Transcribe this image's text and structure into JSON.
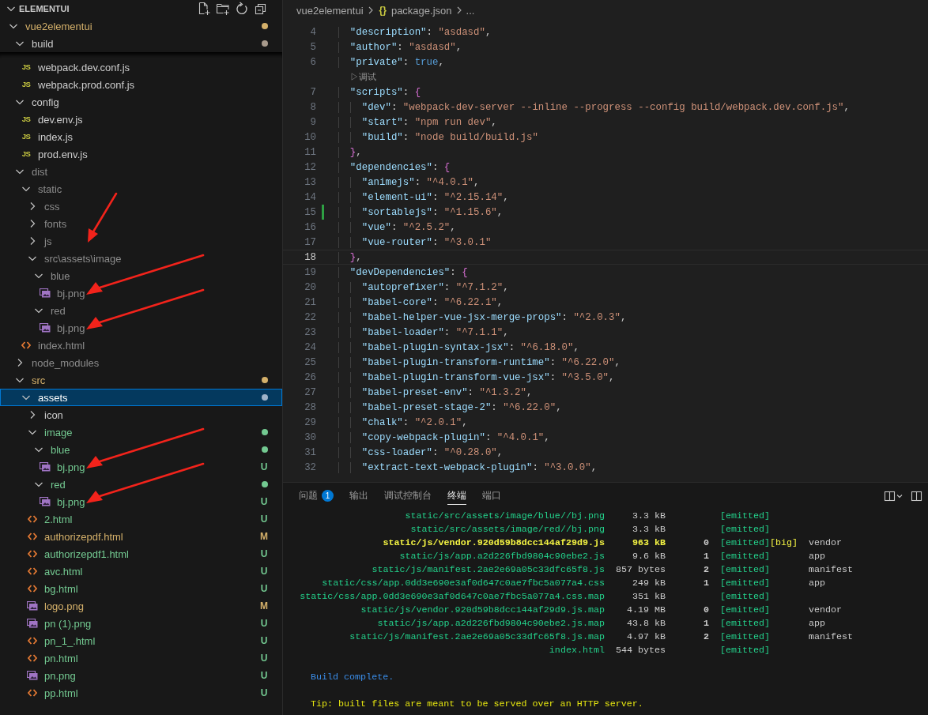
{
  "explorer": {
    "title": "ELEMENTUI",
    "tree": [
      {
        "name": "vue2elementui",
        "kind": "folder",
        "expanded": true,
        "color": "#d4b06a",
        "dot": true,
        "selected": false,
        "children": [
          {
            "name": "build",
            "kind": "folder",
            "expanded": true,
            "color": "#a89a8c",
            "dot": true,
            "selected": false,
            "children": [
              {
                "name": "webpack.dev.conf.js",
                "kind": "js",
                "icon_text": "JS",
                "color": "#cccccc",
                "selected": false
              },
              {
                "name": "webpack.prod.conf.js",
                "kind": "js",
                "icon_text": "JS",
                "color": "#cccccc",
                "selected": false
              }
            ]
          },
          {
            "name": "config",
            "kind": "folder",
            "expanded": true,
            "color": "#cccccc",
            "selected": false,
            "children": [
              {
                "name": "dev.env.js",
                "kind": "js",
                "icon_text": "JS",
                "color": "#cccccc",
                "selected": false
              },
              {
                "name": "index.js",
                "kind": "js",
                "icon_text": "JS",
                "color": "#cccccc",
                "selected": false
              },
              {
                "name": "prod.env.js",
                "kind": "js",
                "icon_text": "JS",
                "color": "#cccccc",
                "selected": false
              }
            ]
          },
          {
            "name": "dist",
            "kind": "folder",
            "expanded": true,
            "color": "#8c8c8c",
            "selected": false,
            "children": [
              {
                "name": "static",
                "kind": "folder",
                "expanded": true,
                "color": "#8c8c8c",
                "selected": false,
                "children": [
                  {
                    "name": "css",
                    "kind": "folder",
                    "expanded": false,
                    "color": "#8c8c8c",
                    "selected": false
                  },
                  {
                    "name": "fonts",
                    "kind": "folder",
                    "expanded": false,
                    "color": "#8c8c8c",
                    "selected": false
                  },
                  {
                    "name": "js",
                    "kind": "folder",
                    "expanded": false,
                    "color": "#8c8c8c",
                    "selected": false,
                    "arrow": true
                  },
                  {
                    "name": "src\\assets\\image",
                    "kind": "folder",
                    "expanded": true,
                    "color": "#8c8c8c",
                    "selected": false,
                    "children": [
                      {
                        "name": "blue",
                        "kind": "folder",
                        "expanded": true,
                        "color": "#8c8c8c",
                        "selected": false,
                        "children": [
                          {
                            "name": "bj.png",
                            "kind": "image",
                            "color": "#8c8c8c",
                            "selected": false,
                            "arrow": true
                          }
                        ]
                      },
                      {
                        "name": "red",
                        "kind": "folder",
                        "expanded": true,
                        "color": "#8c8c8c",
                        "selected": false,
                        "children": [
                          {
                            "name": "bj.png",
                            "kind": "image",
                            "color": "#8c8c8c",
                            "selected": false,
                            "arrow": true
                          }
                        ]
                      }
                    ]
                  }
                ]
              },
              {
                "name": "index.html",
                "kind": "html",
                "color": "#8c8c8c",
                "selected": false
              }
            ]
          },
          {
            "name": "node_modules",
            "kind": "folder",
            "expanded": false,
            "color": "#8c8c8c",
            "selected": false
          },
          {
            "name": "src",
            "kind": "folder",
            "expanded": true,
            "color": "#d4b06a",
            "dot": true,
            "selected": false,
            "children": [
              {
                "name": "assets",
                "kind": "folder",
                "expanded": true,
                "color": "#9fb3c8",
                "dot": true,
                "selected": true,
                "children": [
                  {
                    "name": "icon",
                    "kind": "folder",
                    "expanded": false,
                    "color": "#cccccc",
                    "selected": false
                  },
                  {
                    "name": "image",
                    "kind": "folder",
                    "expanded": true,
                    "color": "#73c991",
                    "dot": true,
                    "selected": false,
                    "children": [
                      {
                        "name": "blue",
                        "kind": "folder",
                        "expanded": true,
                        "color": "#73c991",
                        "dot": true,
                        "selected": false,
                        "children": [
                          {
                            "name": "bj.png",
                            "kind": "image",
                            "color": "#73c991",
                            "badge": "U",
                            "selected": false,
                            "arrow": true
                          }
                        ]
                      },
                      {
                        "name": "red",
                        "kind": "folder",
                        "expanded": true,
                        "color": "#73c991",
                        "dot": true,
                        "selected": false,
                        "children": [
                          {
                            "name": "bj.png",
                            "kind": "image",
                            "color": "#73c991",
                            "badge": "U",
                            "selected": false,
                            "arrow": true
                          }
                        ]
                      }
                    ]
                  },
                  {
                    "name": "2.html",
                    "kind": "html",
                    "color": "#73c991",
                    "badge": "U",
                    "selected": false
                  },
                  {
                    "name": "authorizepdf.html",
                    "kind": "html",
                    "color": "#d4b06a",
                    "badge": "M",
                    "selected": false
                  },
                  {
                    "name": "authorizepdf1.html",
                    "kind": "html",
                    "color": "#73c991",
                    "badge": "U",
                    "selected": false
                  },
                  {
                    "name": "avc.html",
                    "kind": "html",
                    "color": "#73c991",
                    "badge": "U",
                    "selected": false
                  },
                  {
                    "name": "bg.html",
                    "kind": "html",
                    "color": "#73c991",
                    "badge": "U",
                    "selected": false
                  },
                  {
                    "name": "logo.png",
                    "kind": "image",
                    "color": "#d4b06a",
                    "badge": "M",
                    "selected": false
                  },
                  {
                    "name": "pn (1).png",
                    "kind": "image",
                    "color": "#73c991",
                    "badge": "U",
                    "selected": false
                  },
                  {
                    "name": "pn_1_.html",
                    "kind": "html",
                    "color": "#73c991",
                    "badge": "U",
                    "selected": false
                  },
                  {
                    "name": "pn.html",
                    "kind": "html",
                    "color": "#73c991",
                    "badge": "U",
                    "selected": false
                  },
                  {
                    "name": "pn.png",
                    "kind": "image",
                    "color": "#73c991",
                    "badge": "U",
                    "selected": false
                  },
                  {
                    "name": "pp.html",
                    "kind": "html",
                    "color": "#73c991",
                    "badge": "U",
                    "selected": false
                  }
                ]
              }
            ]
          }
        ]
      }
    ]
  },
  "editor": {
    "breadcrumb": {
      "folder": "vue2elementui",
      "file_icon": "{}",
      "file": "package.json",
      "more": "..."
    },
    "lines": [
      {
        "kind": "code",
        "number": "4",
        "changed": false,
        "current": false,
        "tokens": [
          {
            "kind": "key",
            "text": "  \"description\""
          },
          {
            "kind": "punct",
            "text": ": "
          },
          {
            "kind": "string",
            "text": "\"asdasd\""
          },
          {
            "kind": "punct",
            "text": ","
          }
        ]
      },
      {
        "kind": "code",
        "number": "5",
        "changed": false,
        "current": false,
        "tokens": [
          {
            "kind": "key",
            "text": "  \"author\""
          },
          {
            "kind": "punct",
            "text": ": "
          },
          {
            "kind": "string",
            "text": "\"asdasd\""
          },
          {
            "kind": "punct",
            "text": ","
          }
        ]
      },
      {
        "kind": "code",
        "number": "6",
        "changed": false,
        "current": false,
        "tokens": [
          {
            "kind": "key",
            "text": "  \"private\""
          },
          {
            "kind": "punct",
            "text": ": "
          },
          {
            "kind": "boolean",
            "text": "true"
          },
          {
            "kind": "punct",
            "text": ","
          }
        ]
      },
      {
        "kind": "codelens",
        "text": "▷调试"
      },
      {
        "kind": "code",
        "number": "7",
        "changed": false,
        "current": false,
        "tokens": [
          {
            "kind": "key",
            "text": "  \"scripts\""
          },
          {
            "kind": "punct",
            "text": ": "
          },
          {
            "kind": "bracket",
            "text": "{"
          }
        ]
      },
      {
        "kind": "code",
        "number": "8",
        "changed": false,
        "current": false,
        "tokens": [
          {
            "kind": "key",
            "text": "    \"dev\""
          },
          {
            "kind": "punct",
            "text": ": "
          },
          {
            "kind": "string",
            "text": "\"webpack-dev-server --inline --progress --config build/webpack.dev.conf.js\""
          },
          {
            "kind": "punct",
            "text": ","
          }
        ]
      },
      {
        "kind": "code",
        "number": "9",
        "changed": false,
        "current": false,
        "tokens": [
          {
            "kind": "key",
            "text": "    \"start\""
          },
          {
            "kind": "punct",
            "text": ": "
          },
          {
            "kind": "string",
            "text": "\"npm run dev\""
          },
          {
            "kind": "punct",
            "text": ","
          }
        ]
      },
      {
        "kind": "code",
        "number": "10",
        "changed": false,
        "current": false,
        "tokens": [
          {
            "kind": "key",
            "text": "    \"build\""
          },
          {
            "kind": "punct",
            "text": ": "
          },
          {
            "kind": "string",
            "text": "\"node build/build.js\""
          }
        ]
      },
      {
        "kind": "code",
        "number": "11",
        "changed": false,
        "current": false,
        "tokens": [
          {
            "kind": "bracket",
            "text": "  }"
          },
          {
            "kind": "punct",
            "text": ","
          }
        ]
      },
      {
        "kind": "code",
        "number": "12",
        "changed": false,
        "current": false,
        "tokens": [
          {
            "kind": "key",
            "text": "  \"dependencies\""
          },
          {
            "kind": "punct",
            "text": ": "
          },
          {
            "kind": "bracket",
            "text": "{"
          }
        ]
      },
      {
        "kind": "code",
        "number": "13",
        "changed": false,
        "current": false,
        "tokens": [
          {
            "kind": "key",
            "text": "    \"animejs\""
          },
          {
            "kind": "punct",
            "text": ": "
          },
          {
            "kind": "string",
            "text": "\"^4.0.1\""
          },
          {
            "kind": "punct",
            "text": ","
          }
        ]
      },
      {
        "kind": "code",
        "number": "14",
        "changed": false,
        "current": false,
        "tokens": [
          {
            "kind": "key",
            "text": "    \"element-ui\""
          },
          {
            "kind": "punct",
            "text": ": "
          },
          {
            "kind": "string",
            "text": "\"^2.15.14\""
          },
          {
            "kind": "punct",
            "text": ","
          }
        ]
      },
      {
        "kind": "code",
        "number": "15",
        "changed": true,
        "current": false,
        "tokens": [
          {
            "kind": "key",
            "text": "    \"sortablejs\""
          },
          {
            "kind": "punct",
            "text": ": "
          },
          {
            "kind": "string",
            "text": "\"^1.15.6\""
          },
          {
            "kind": "punct",
            "text": ","
          }
        ]
      },
      {
        "kind": "code",
        "number": "16",
        "changed": false,
        "current": false,
        "tokens": [
          {
            "kind": "key",
            "text": "    \"vue\""
          },
          {
            "kind": "punct",
            "text": ": "
          },
          {
            "kind": "string",
            "text": "\"^2.5.2\""
          },
          {
            "kind": "punct",
            "text": ","
          }
        ]
      },
      {
        "kind": "code",
        "number": "17",
        "changed": false,
        "current": false,
        "tokens": [
          {
            "kind": "key",
            "text": "    \"vue-router\""
          },
          {
            "kind": "punct",
            "text": ": "
          },
          {
            "kind": "string",
            "text": "\"^3.0.1\""
          }
        ]
      },
      {
        "kind": "code",
        "number": "18",
        "changed": false,
        "current": true,
        "tokens": [
          {
            "kind": "bracket",
            "text": "  }"
          },
          {
            "kind": "punct",
            "text": ","
          }
        ]
      },
      {
        "kind": "code",
        "number": "19",
        "changed": false,
        "current": false,
        "tokens": [
          {
            "kind": "key",
            "text": "  \"devDependencies\""
          },
          {
            "kind": "punct",
            "text": ": "
          },
          {
            "kind": "bracket",
            "text": "{"
          }
        ]
      },
      {
        "kind": "code",
        "number": "20",
        "changed": false,
        "current": false,
        "tokens": [
          {
            "kind": "key",
            "text": "    \"autoprefixer\""
          },
          {
            "kind": "punct",
            "text": ": "
          },
          {
            "kind": "string",
            "text": "\"^7.1.2\""
          },
          {
            "kind": "punct",
            "text": ","
          }
        ]
      },
      {
        "kind": "code",
        "number": "21",
        "changed": false,
        "current": false,
        "tokens": [
          {
            "kind": "key",
            "text": "    \"babel-core\""
          },
          {
            "kind": "punct",
            "text": ": "
          },
          {
            "kind": "string",
            "text": "\"^6.22.1\""
          },
          {
            "kind": "punct",
            "text": ","
          }
        ]
      },
      {
        "kind": "code",
        "number": "22",
        "changed": false,
        "current": false,
        "tokens": [
          {
            "kind": "key",
            "text": "    \"babel-helper-vue-jsx-merge-props\""
          },
          {
            "kind": "punct",
            "text": ": "
          },
          {
            "kind": "string",
            "text": "\"^2.0.3\""
          },
          {
            "kind": "punct",
            "text": ","
          }
        ]
      },
      {
        "kind": "code",
        "number": "23",
        "changed": false,
        "current": false,
        "tokens": [
          {
            "kind": "key",
            "text": "    \"babel-loader\""
          },
          {
            "kind": "punct",
            "text": ": "
          },
          {
            "kind": "string",
            "text": "\"^7.1.1\""
          },
          {
            "kind": "punct",
            "text": ","
          }
        ]
      },
      {
        "kind": "code",
        "number": "24",
        "changed": false,
        "current": false,
        "tokens": [
          {
            "kind": "key",
            "text": "    \"babel-plugin-syntax-jsx\""
          },
          {
            "kind": "punct",
            "text": ": "
          },
          {
            "kind": "string",
            "text": "\"^6.18.0\""
          },
          {
            "kind": "punct",
            "text": ","
          }
        ]
      },
      {
        "kind": "code",
        "number": "25",
        "changed": false,
        "current": false,
        "tokens": [
          {
            "kind": "key",
            "text": "    \"babel-plugin-transform-runtime\""
          },
          {
            "kind": "punct",
            "text": ": "
          },
          {
            "kind": "string",
            "text": "\"^6.22.0\""
          },
          {
            "kind": "punct",
            "text": ","
          }
        ]
      },
      {
        "kind": "code",
        "number": "26",
        "changed": false,
        "current": false,
        "tokens": [
          {
            "kind": "key",
            "text": "    \"babel-plugin-transform-vue-jsx\""
          },
          {
            "kind": "punct",
            "text": ": "
          },
          {
            "kind": "string",
            "text": "\"^3.5.0\""
          },
          {
            "kind": "punct",
            "text": ","
          }
        ]
      },
      {
        "kind": "code",
        "number": "27",
        "changed": false,
        "current": false,
        "tokens": [
          {
            "kind": "key",
            "text": "    \"babel-preset-env\""
          },
          {
            "kind": "punct",
            "text": ": "
          },
          {
            "kind": "string",
            "text": "\"^1.3.2\""
          },
          {
            "kind": "punct",
            "text": ","
          }
        ]
      },
      {
        "kind": "code",
        "number": "28",
        "changed": false,
        "current": false,
        "tokens": [
          {
            "kind": "key",
            "text": "    \"babel-preset-stage-2\""
          },
          {
            "kind": "punct",
            "text": ": "
          },
          {
            "kind": "string",
            "text": "\"^6.22.0\""
          },
          {
            "kind": "punct",
            "text": ","
          }
        ]
      },
      {
        "kind": "code",
        "number": "29",
        "changed": false,
        "current": false,
        "tokens": [
          {
            "kind": "key",
            "text": "    \"chalk\""
          },
          {
            "kind": "punct",
            "text": ": "
          },
          {
            "kind": "string",
            "text": "\"^2.0.1\""
          },
          {
            "kind": "punct",
            "text": ","
          }
        ]
      },
      {
        "kind": "code",
        "number": "30",
        "changed": false,
        "current": false,
        "tokens": [
          {
            "kind": "key",
            "text": "    \"copy-webpack-plugin\""
          },
          {
            "kind": "punct",
            "text": ": "
          },
          {
            "kind": "string",
            "text": "\"^4.0.1\""
          },
          {
            "kind": "punct",
            "text": ","
          }
        ]
      },
      {
        "kind": "code",
        "number": "31",
        "changed": false,
        "current": false,
        "tokens": [
          {
            "kind": "key",
            "text": "    \"css-loader\""
          },
          {
            "kind": "punct",
            "text": ": "
          },
          {
            "kind": "string",
            "text": "\"^0.28.0\""
          },
          {
            "kind": "punct",
            "text": ","
          }
        ]
      },
      {
        "kind": "code",
        "number": "32",
        "changed": false,
        "current": false,
        "tokens": [
          {
            "kind": "key",
            "text": "    \"extract-text-webpack-plugin\""
          },
          {
            "kind": "punct",
            "text": ": "
          },
          {
            "kind": "string",
            "text": "\"^3.0.0\""
          },
          {
            "kind": "punct",
            "text": ","
          }
        ]
      }
    ]
  },
  "panel": {
    "tabs": [
      {
        "label": "问题",
        "badge": "1",
        "selected": false
      },
      {
        "label": "输出",
        "selected": false
      },
      {
        "label": "调试控制台",
        "selected": false
      },
      {
        "label": "终端",
        "selected": true
      },
      {
        "label": "端口",
        "selected": false
      }
    ],
    "terminal": {
      "assets": [
        {
          "asset": "static/src/assets/image/blue//bj.png",
          "size": "3.3 kB",
          "status": "[emitted]",
          "big": false
        },
        {
          "asset": "static/src/assets/image/red//bj.png",
          "size": "3.3 kB",
          "status": "[emitted]",
          "big": false
        },
        {
          "asset": "static/js/vendor.920d59b8dcc144af29d9.js",
          "size": "963 kB",
          "chunks": "0",
          "status": "[emitted]",
          "flag": "[big]",
          "names": "vendor",
          "big": true
        },
        {
          "asset": "static/js/app.a2d226fbd9804c90ebe2.js",
          "size": "9.6 kB",
          "chunks": "1",
          "status": "[emitted]",
          "names": "app",
          "big": false
        },
        {
          "asset": "static/js/manifest.2ae2e69a05c33dfc65f8.js",
          "size": "857 bytes",
          "chunks": "2",
          "status": "[emitted]",
          "names": "manifest",
          "big": false
        },
        {
          "asset": "static/css/app.0dd3e690e3af0d647c0ae7fbc5a077a4.css",
          "size": "249 kB",
          "chunks": "1",
          "status": "[emitted]",
          "names": "app",
          "big": false
        },
        {
          "asset": "static/css/app.0dd3e690e3af0d647c0ae7fbc5a077a4.css.map",
          "size": "351 kB",
          "status": "[emitted]",
          "big": false
        },
        {
          "asset": "static/js/vendor.920d59b8dcc144af29d9.js.map",
          "size": "4.19 MB",
          "chunks": "0",
          "status": "[emitted]",
          "names": "vendor",
          "big": false
        },
        {
          "asset": "static/js/app.a2d226fbd9804c90ebe2.js.map",
          "size": "43.8 kB",
          "chunks": "1",
          "status": "[emitted]",
          "names": "app",
          "big": false
        },
        {
          "asset": "static/js/manifest.2ae2e69a05c33dfc65f8.js.map",
          "size": "4.97 kB",
          "chunks": "2",
          "status": "[emitted]",
          "names": "manifest",
          "big": false
        },
        {
          "asset": "index.html",
          "size": "544 bytes",
          "status": "[emitted]",
          "big": false
        }
      ],
      "messages": [
        {
          "kind": "success",
          "text": "Build complete."
        },
        {
          "kind": "tip",
          "text": "Tip: built files are meant to be served over an HTTP server."
        }
      ]
    }
  }
}
